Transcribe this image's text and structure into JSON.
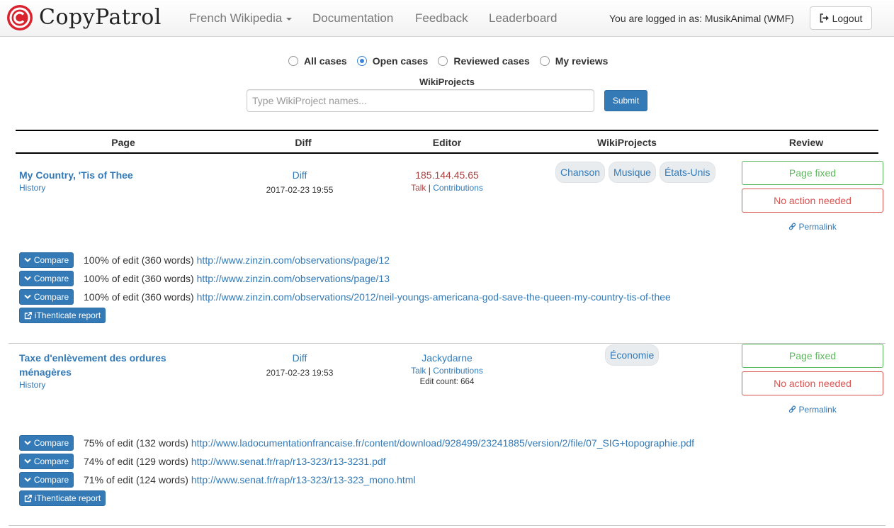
{
  "nav": {
    "brand": "CopyPatrol",
    "wiki_dropdown": "French Wikipedia",
    "links": [
      "Documentation",
      "Feedback",
      "Leaderboard"
    ],
    "login_text": "You are logged in as: MusikAnimal (WMF)",
    "logout": "Logout"
  },
  "filters": {
    "options": [
      "All cases",
      "Open cases",
      "Reviewed cases",
      "My reviews"
    ],
    "selected": "Open cases",
    "wikiprojects_label": "WikiProjects",
    "wikiprojects_placeholder": "Type WikiProject names...",
    "submit": "Submit"
  },
  "table": {
    "headers": [
      "Page",
      "Diff",
      "Editor",
      "WikiProjects",
      "Review"
    ]
  },
  "records": [
    {
      "page_title": "My Country, 'Tis of Thee",
      "history": "History",
      "diff": "Diff",
      "date": "2017-02-23 19:55",
      "editor": "185.144.45.65",
      "talk": "Talk",
      "contributions": "Contributions",
      "wikiprojects": [
        "Chanson",
        "Musique",
        "États-Unis"
      ],
      "page_fixed": "Page fixed",
      "no_action": "No action needed",
      "permalink": "Permalink",
      "matches": [
        {
          "compare": "Compare",
          "text": "100% of edit (360 words)",
          "url": "http://www.zinzin.com/observations/page/12"
        },
        {
          "compare": "Compare",
          "text": "100% of edit (360 words)",
          "url": "http://www.zinzin.com/observations/page/13"
        },
        {
          "compare": "Compare",
          "text": "100% of edit (360 words)",
          "url": "http://www.zinzin.com/observations/2012/neil-youngs-americana-god-save-the-queen-my-country-tis-of-thee"
        }
      ],
      "report": "iThenticate report"
    },
    {
      "page_title": "Taxe d'enlèvement des ordures ménagères",
      "history": "History",
      "diff": "Diff",
      "date": "2017-02-23 19:53",
      "editor": "Jackydarne",
      "talk": "Talk",
      "contributions": "Contributions",
      "edit_count": "Edit count: 664",
      "wikiprojects": [
        "Économie"
      ],
      "page_fixed": "Page fixed",
      "no_action": "No action needed",
      "permalink": "Permalink",
      "matches": [
        {
          "compare": "Compare",
          "text": "75% of edit (132 words)",
          "url": "http://www.ladocumentationfrancaise.fr/content/download/928499/23241885/version/2/file/07_SIG+topographie.pdf"
        },
        {
          "compare": "Compare",
          "text": "74% of edit (129 words)",
          "url": "http://www.senat.fr/rap/r13-323/r13-3231.pdf"
        },
        {
          "compare": "Compare",
          "text": "71% of edit (124 words)",
          "url": "http://www.senat.fr/rap/r13-323/r13-323_mono.html"
        }
      ],
      "report": "iThenticate report"
    }
  ],
  "colors": {
    "link": "#337ab7",
    "primary": "#337ab7",
    "success": "#5cb85c",
    "danger": "#d9534f",
    "ip_editor": "#a94442",
    "logo": "#d9232e"
  }
}
